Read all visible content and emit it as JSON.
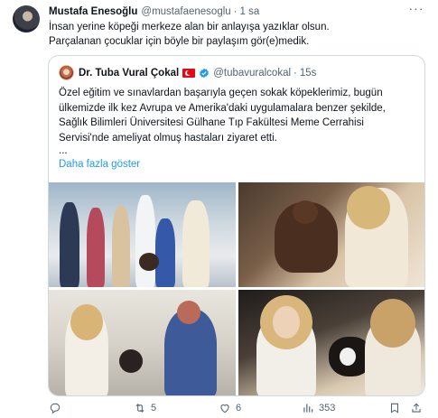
{
  "tweet": {
    "author_name": "Mustafa Enesoğlu",
    "author_handle": "@mustafaenesoglu",
    "separator": "·",
    "time": "1 sa",
    "text_lines": [
      "İnsan yerine köpeği merkeze alan bir anlayışa yazıklar olsun.",
      "Parçalanan çocuklar için böyle bir paylaşım gör(e)medik."
    ]
  },
  "quote": {
    "author_name": "Dr. Tuba Vural Çokal",
    "author_handle": "@tubavuralcokal",
    "separator": "·",
    "time": "15s",
    "text_lines": [
      "Özel eğitim ve sınavlardan başarıyla geçen sokak köpeklerimiz, bugün",
      "ülkemizde ilk kez Avrupa ve Amerika'daki uygulamalara benzer şekilde,",
      "Sağlık Bilimleri Üniversitesi Gülhane Tıp Fakültesi Meme Cerrahisi",
      "Servisi'nde ameliyat olmuş hastaları ziyaret etti."
    ],
    "ellipsis": "...",
    "show_more": "Daha fazla göster"
  },
  "actions": {
    "reply_count": "",
    "retweet_count": "5",
    "like_count": "6",
    "views_count": "353"
  },
  "colors": {
    "link": "#1d9bf0",
    "secondary_text": "#536471",
    "border": "#cfd9de",
    "flag_red": "#e30a17"
  },
  "icons": [
    "more-icon",
    "flag-icon",
    "verified-icon",
    "reply-icon",
    "retweet-icon",
    "like-icon",
    "views-icon",
    "bookmark-icon",
    "share-icon"
  ]
}
